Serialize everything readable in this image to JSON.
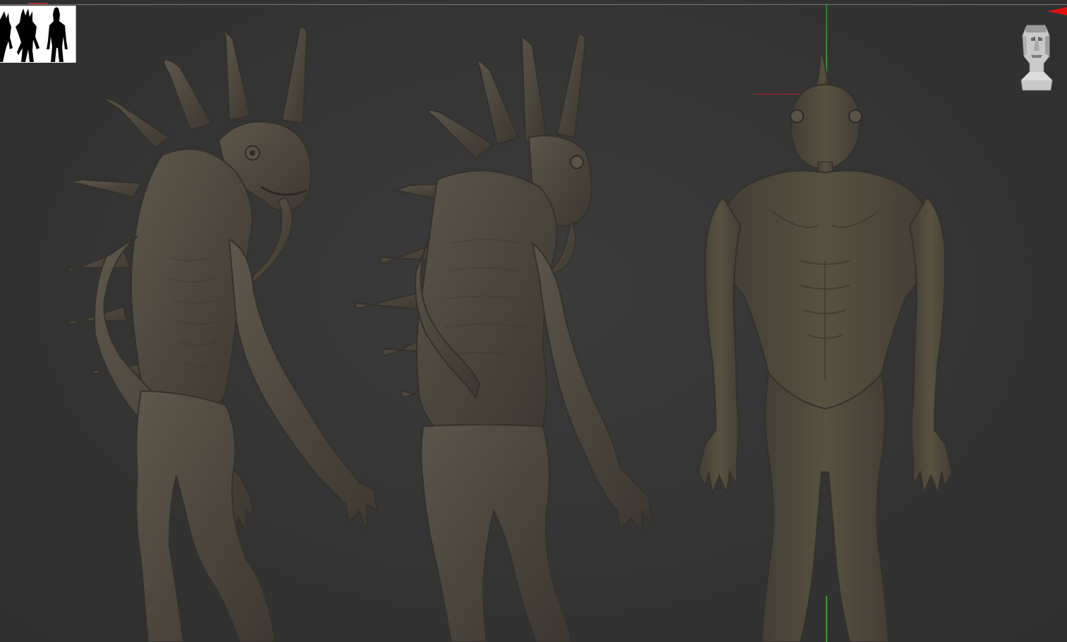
{
  "viewport": {
    "background": "#333333",
    "model_color": "#4f493f",
    "axis_x_color": "#b22222",
    "axis_y_color": "#3b9c3b",
    "arrow_color": "#e01010"
  },
  "icons": {
    "thumbnail": "creature-silhouettes-thumbnail",
    "navigator": "head-orientation-icon",
    "arrow": "red-arrow-icon"
  },
  "views": [
    {
      "name": "three-quarter-front"
    },
    {
      "name": "three-quarter-back"
    },
    {
      "name": "front"
    }
  ]
}
